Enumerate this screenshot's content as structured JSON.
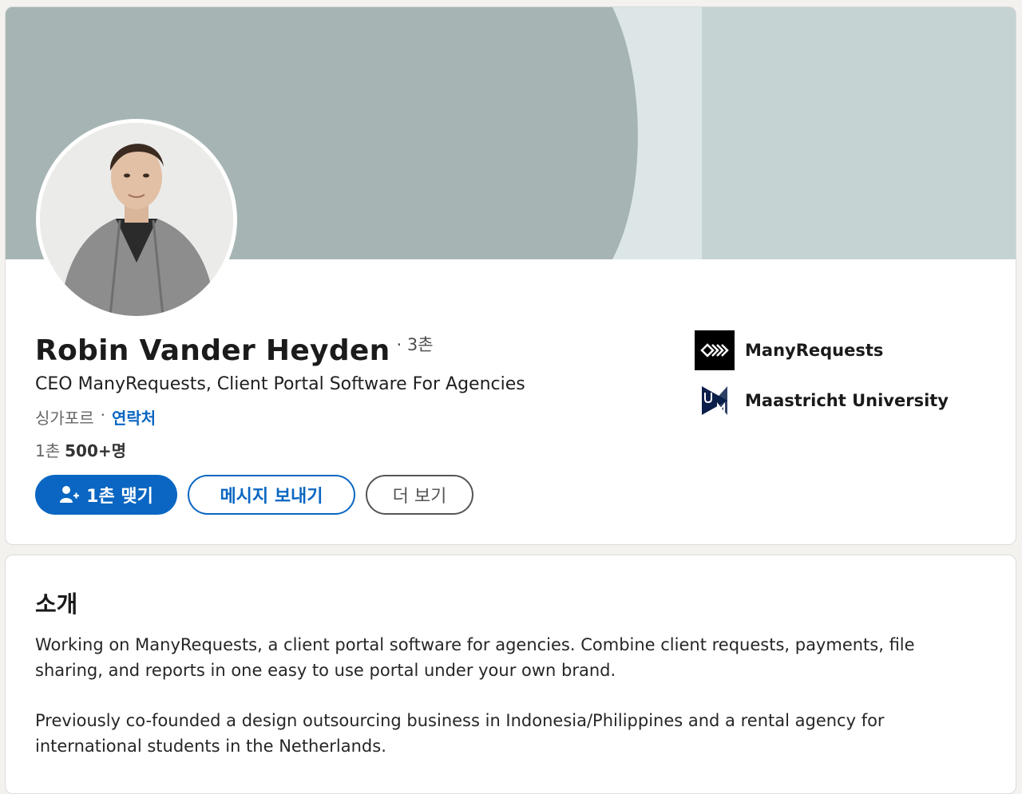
{
  "profile": {
    "name": "Robin Vander Heyden",
    "degree": "· 3촌",
    "headline": "CEO ManyRequests, Client Portal Software For Agencies",
    "location": "싱가포르",
    "location_separator": "·",
    "contact_link": "연락처",
    "connections_label": "1촌",
    "connections_count": "500+명",
    "actions": {
      "connect": "1촌 맺기",
      "message": "메시지 보내기",
      "more": "더 보기"
    },
    "side_items": [
      {
        "label": "ManyRequests",
        "icon": "manyrequests-logo-icon"
      },
      {
        "label": "Maastricht University",
        "icon": "maastricht-university-logo-icon"
      }
    ]
  },
  "about": {
    "title": "소개",
    "paragraphs": [
      "Working on ManyRequests, a client portal software for agencies. Combine client requests, payments, file sharing, and reports in one easy to use portal under your own brand.",
      "Previously co-founded a design outsourcing business in Indonesia/Philippines and a rental agency for international students in the Netherlands."
    ]
  },
  "colors": {
    "accent": "#0a66c2",
    "cover_primary": "#a6b5b4",
    "cover_light": "#dde6e6",
    "cover_right": "#c5d3d3"
  }
}
